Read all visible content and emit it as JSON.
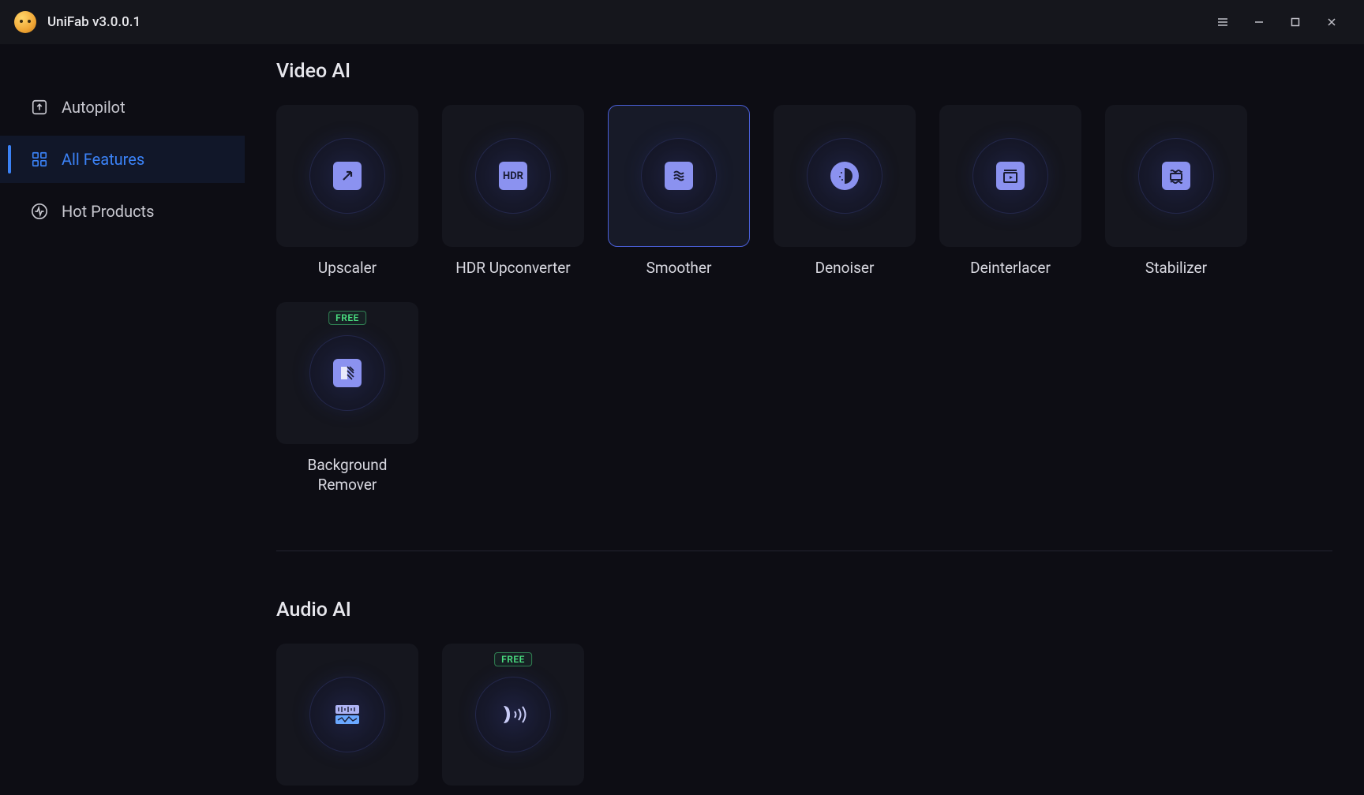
{
  "app": {
    "title": "UniFab v3.0.0.1"
  },
  "sidebar": {
    "items": [
      {
        "label": "Autopilot",
        "icon": "autopilot-icon"
      },
      {
        "label": "All Features",
        "icon": "grid-icon"
      },
      {
        "label": "Hot Products",
        "icon": "pulse-icon"
      }
    ],
    "active_index": 1
  },
  "sections": [
    {
      "title": "Video AI",
      "items": [
        {
          "label": "Upscaler",
          "icon": "upscale-icon",
          "badge": null
        },
        {
          "label": "HDR Upconverter",
          "icon": "hdr-icon",
          "badge": null
        },
        {
          "label": "Smoother",
          "icon": "smoother-icon",
          "badge": null,
          "active": true
        },
        {
          "label": "Denoiser",
          "icon": "denoise-icon",
          "badge": null
        },
        {
          "label": "Deinterlacer",
          "icon": "deinterlace-icon",
          "badge": null
        },
        {
          "label": "Stabilizer",
          "icon": "stabilize-icon",
          "badge": null
        },
        {
          "label": "Background Remover",
          "icon": "bgremove-icon",
          "badge": "FREE"
        }
      ]
    },
    {
      "title": "Audio AI",
      "items": [
        {
          "label": "",
          "icon": "audio1-icon",
          "badge": null
        },
        {
          "label": "",
          "icon": "audio2-icon",
          "badge": "FREE"
        }
      ]
    }
  ],
  "badges": {
    "free": "FREE"
  }
}
